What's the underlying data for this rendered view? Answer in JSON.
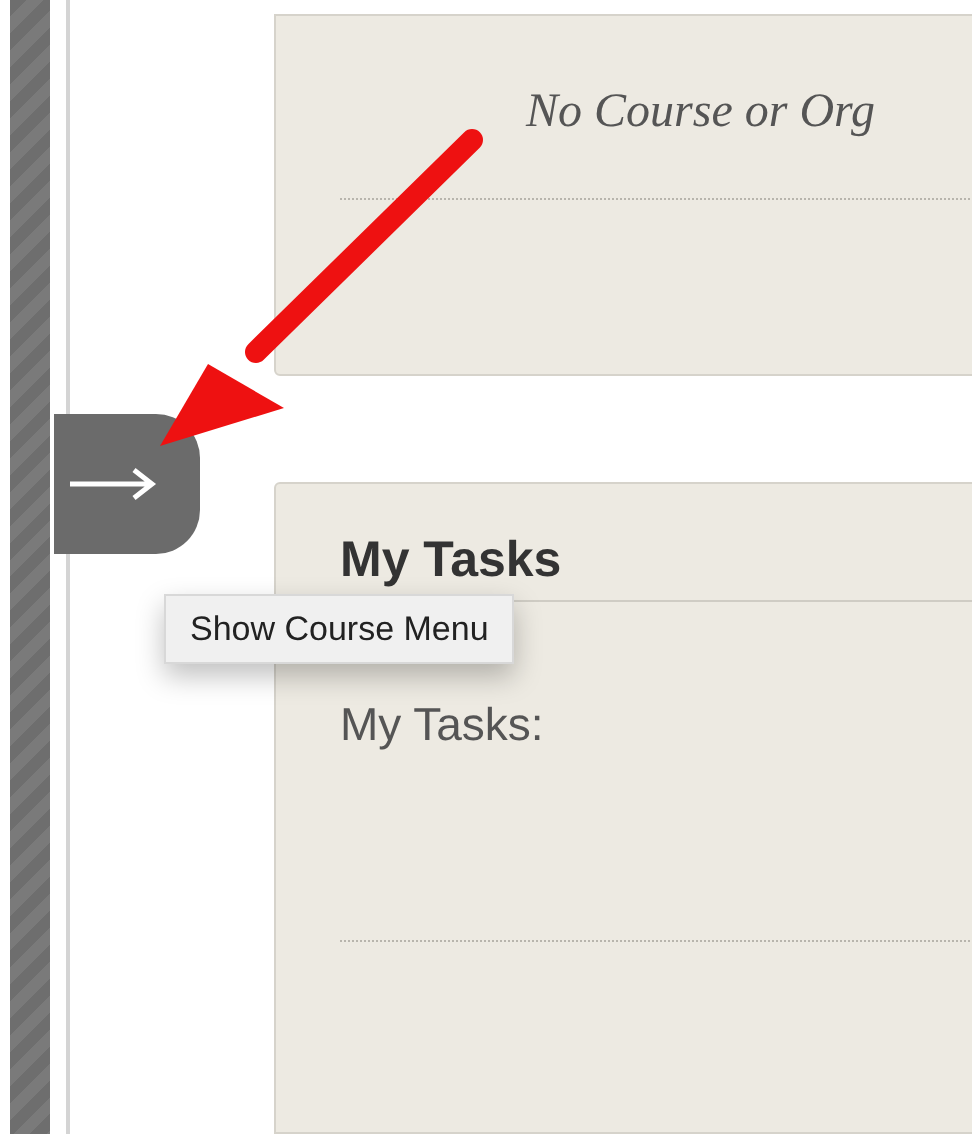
{
  "modules": [
    {
      "kind": "message",
      "text": "No Course or Org"
    },
    {
      "kind": "tasks",
      "title": "My Tasks",
      "body": "My Tasks:"
    }
  ],
  "tooltip": {
    "text": "Show Course Menu"
  }
}
